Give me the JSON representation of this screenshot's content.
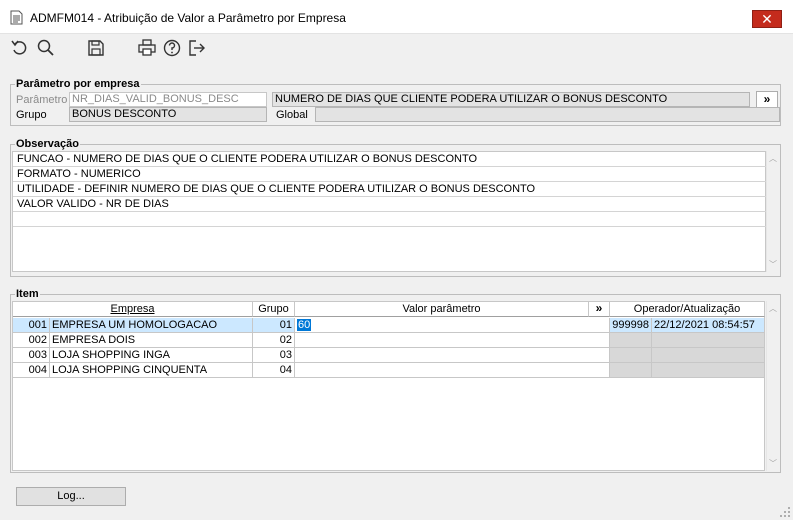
{
  "window": {
    "title": "ADMFM014 - Atribuição de Valor a Parâmetro por Empresa",
    "close_glyph": "✕"
  },
  "toolbar": {
    "icons": [
      "undo-icon",
      "search-icon",
      "save-icon",
      "print-icon",
      "help-icon",
      "exit-icon"
    ]
  },
  "parametro_section": {
    "title": "Parâmetro por empresa",
    "parametro_label": "Parâmetro",
    "parametro_value": "NR_DIAS_VALID_BONUS_DESC",
    "descricao_value": "NUMERO DE DIAS QUE CLIENTE PODERA UTILIZAR O BONUS DESCONTO",
    "expand_label": "»",
    "grupo_label": "Grupo",
    "grupo_value": "BONUS DESCONTO",
    "global_label": "Global",
    "global_value": ""
  },
  "observacao_section": {
    "title": "Observação",
    "lines": [
      "FUNCAO - NUMERO DE DIAS QUE O CLIENTE PODERA UTILIZAR O BONUS DESCONTO",
      "FORMATO - NUMERICO",
      "UTILIDADE - DEFINIR NUMERO DE DIAS QUE O CLIENTE PODERA UTILIZAR O BONUS DESCONTO",
      "VALOR VALIDO - NR DE DIAS",
      ""
    ]
  },
  "item_section": {
    "title": "Item",
    "columns": {
      "empresa": "Empresa",
      "grupo": "Grupo",
      "valor": "Valor parâmetro",
      "expand": "»",
      "operador": "Operador/Atualização"
    },
    "rows": [
      {
        "code": "001",
        "empresa": "EMPRESA UM HOMOLOGACAO",
        "grupo": "01",
        "valor": "60",
        "operador": "999998",
        "atualizacao": "22/12/2021 08:54:57"
      },
      {
        "code": "002",
        "empresa": "EMPRESA DOIS",
        "grupo": "02",
        "valor": "",
        "operador": "",
        "atualizacao": ""
      },
      {
        "code": "003",
        "empresa": "LOJA SHOPPING INGA",
        "grupo": "03",
        "valor": "",
        "operador": "",
        "atualizacao": ""
      },
      {
        "code": "004",
        "empresa": "LOJA SHOPPING CINQUENTA",
        "grupo": "04",
        "valor": "",
        "operador": "",
        "atualizacao": ""
      }
    ]
  },
  "footer": {
    "log_button": "Log..."
  },
  "colors": {
    "close": "#c42b1c",
    "selected_row": "#cce8ff",
    "edit_highlight": "#0078d7"
  }
}
